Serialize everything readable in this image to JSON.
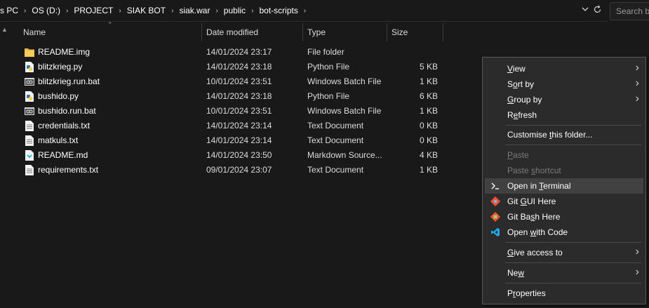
{
  "address": {
    "crumbs": [
      "s PC",
      "OS (D:)",
      "PROJECT",
      "SIAK BOT",
      "siak.war",
      "public",
      "bot-scripts"
    ],
    "separator": "›",
    "search_placeholder": "Search bo"
  },
  "columns": {
    "name": "Name",
    "date": "Date modified",
    "type": "Type",
    "size": "Size"
  },
  "files": [
    {
      "name": "README.img",
      "date": "14/01/2024 23:17",
      "type": "File folder",
      "size": "",
      "icon": "folder-icon"
    },
    {
      "name": "blitzkrieg.py",
      "date": "14/01/2024 23:18",
      "type": "Python File",
      "size": "5 KB",
      "icon": "python-file-icon"
    },
    {
      "name": "blitzkrieg.run.bat",
      "date": "10/01/2024 23:51",
      "type": "Windows Batch File",
      "size": "1 KB",
      "icon": "batch-file-icon"
    },
    {
      "name": "bushido.py",
      "date": "14/01/2024 23:18",
      "type": "Python File",
      "size": "6 KB",
      "icon": "python-file-icon"
    },
    {
      "name": "bushido.run.bat",
      "date": "10/01/2024 23:51",
      "type": "Windows Batch File",
      "size": "1 KB",
      "icon": "batch-file-icon"
    },
    {
      "name": "credentials.txt",
      "date": "14/01/2024 23:14",
      "type": "Text Document",
      "size": "0 KB",
      "icon": "text-file-icon"
    },
    {
      "name": "matkuls.txt",
      "date": "14/01/2024 23:14",
      "type": "Text Document",
      "size": "0 KB",
      "icon": "text-file-icon"
    },
    {
      "name": "README.md",
      "date": "14/01/2024 23:50",
      "type": "Markdown Source...",
      "size": "4 KB",
      "icon": "markdown-file-icon"
    },
    {
      "name": "requirements.txt",
      "date": "09/01/2024 23:07",
      "type": "Text Document",
      "size": "1 KB",
      "icon": "text-file-icon"
    }
  ],
  "menu": {
    "view": {
      "pre": "",
      "key": "V",
      "post": "iew"
    },
    "sort_by": {
      "pre": "S",
      "key": "o",
      "post": "rt by"
    },
    "group_by": {
      "pre": "",
      "key": "G",
      "post": "roup by"
    },
    "refresh": {
      "pre": "R",
      "key": "e",
      "post": "fresh"
    },
    "customise": {
      "pre": "Customise ",
      "key": "t",
      "post": "his folder..."
    },
    "paste": {
      "pre": "",
      "key": "P",
      "post": "aste"
    },
    "paste_shortcut": {
      "pre": "Paste ",
      "key": "s",
      "post": "hortcut"
    },
    "open_terminal": {
      "pre": "Open in ",
      "key": "T",
      "post": "erminal"
    },
    "git_gui": {
      "pre": "Git ",
      "key": "G",
      "post": "UI Here"
    },
    "git_bash": {
      "pre": "Git Ba",
      "key": "s",
      "post": "h Here"
    },
    "open_code": {
      "pre": "Open ",
      "key": "w",
      "post": "ith Code"
    },
    "give_access": {
      "pre": "",
      "key": "G",
      "post": "ive access to"
    },
    "new": {
      "pre": "Ne",
      "key": "w",
      "post": ""
    },
    "properties": {
      "pre": "P",
      "key": "r",
      "post": "operties"
    }
  },
  "colors": {
    "background": "#191919",
    "menu_bg": "#2b2b2b",
    "highlight": "#414141",
    "vscode_blue": "#23a9f2",
    "git_orange": "#f05133"
  }
}
